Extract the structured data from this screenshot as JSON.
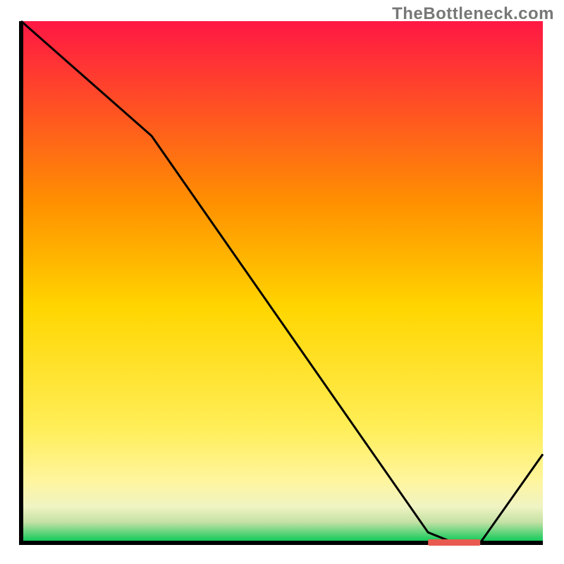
{
  "watermark": "TheBottleneck.com",
  "colors": {
    "axis": "#000000",
    "curve": "#000000",
    "marker_fill": "#e85a4f",
    "gradient_top": "#ff1744",
    "gradient_upper_mid": "#ff9100",
    "gradient_mid": "#ffd600",
    "gradient_lower_mid": "#ffee58",
    "gradient_low": "#fff59d",
    "gradient_pale": "#f0f4c3",
    "gradient_green_pale": "#c5e1a5",
    "gradient_green": "#00c853"
  },
  "chart_data": {
    "type": "line",
    "title": "",
    "xlabel": "",
    "ylabel": "",
    "xlim": [
      0,
      100
    ],
    "ylim": [
      0,
      100
    ],
    "x": [
      0,
      25,
      78,
      83,
      88,
      100
    ],
    "values": [
      100,
      78,
      2,
      0,
      0,
      17
    ],
    "marker": {
      "x_start": 78,
      "x_end": 88,
      "y": 0
    },
    "legend": null,
    "grid": false
  }
}
